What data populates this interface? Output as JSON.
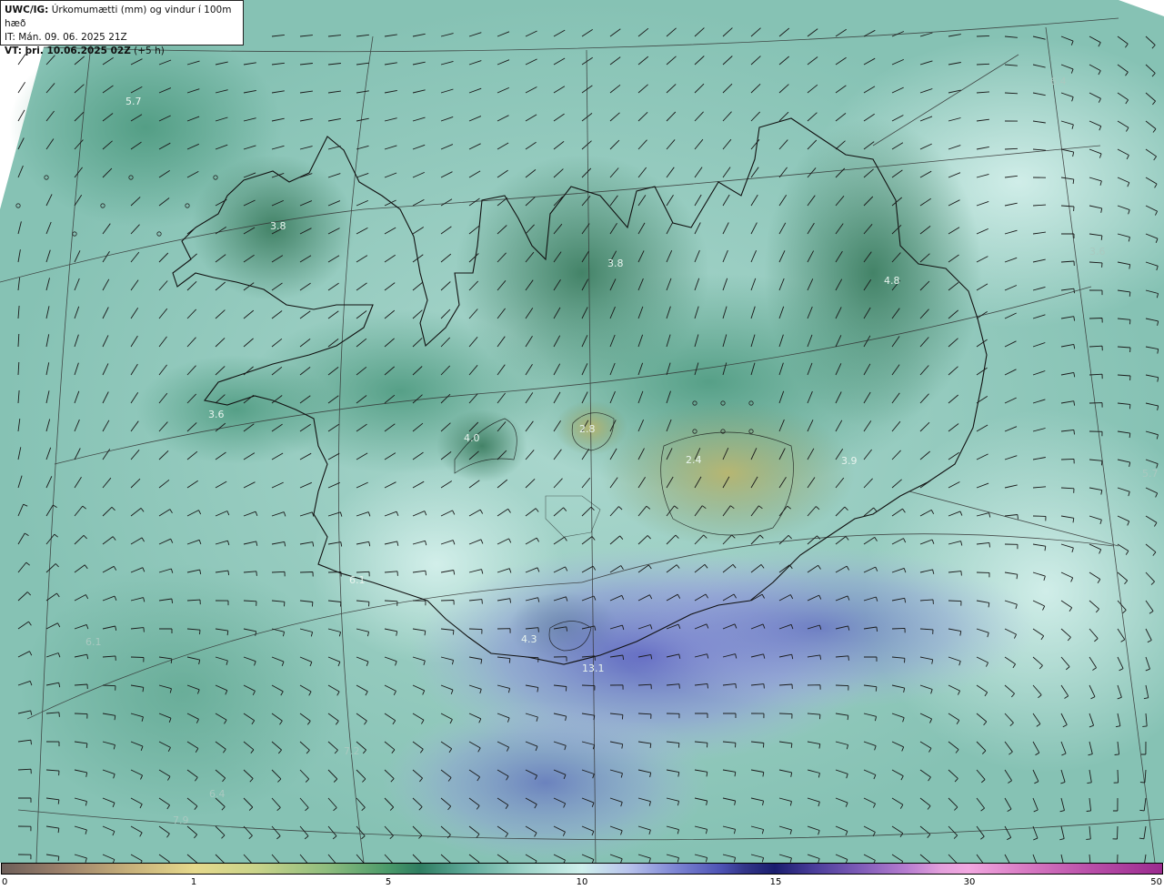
{
  "header": {
    "line1_bold": "UWC/IG:",
    "line1_text": " Úrkomumætti (mm) og vindur í 100m hæð",
    "line2_text": "IT: Mán. 09. 06. 2025 21Z",
    "line3_bold": "VT: þri. 10.06.2025 02Z",
    "line3_text": " (+5 h)"
  },
  "map": {
    "labels": [
      {
        "text": "5.7",
        "faint": false
      },
      {
        "text": "3.8",
        "faint": false
      },
      {
        "text": "3.8",
        "faint": false
      },
      {
        "text": "4.8",
        "faint": false
      },
      {
        "text": "3.6",
        "faint": false
      },
      {
        "text": "4.0",
        "faint": false
      },
      {
        "text": "2.8",
        "faint": false
      },
      {
        "text": "2.4",
        "faint": false
      },
      {
        "text": "3.9",
        "faint": false
      },
      {
        "text": "6.1",
        "faint": false
      },
      {
        "text": "4.3",
        "faint": false
      },
      {
        "text": "13.1",
        "faint": false
      },
      {
        "text": "3.6",
        "faint": true
      },
      {
        "text": "5.7",
        "faint": true
      },
      {
        "text": "6.1",
        "faint": true
      },
      {
        "text": "7.2",
        "faint": true
      },
      {
        "text": "6.4",
        "faint": true
      },
      {
        "text": "7.9",
        "faint": true
      },
      {
        "text": "6.4",
        "faint": true
      }
    ]
  },
  "colorbar": {
    "ticks": [
      "0",
      "1",
      "5",
      "10",
      "15",
      "30",
      "50"
    ]
  }
}
